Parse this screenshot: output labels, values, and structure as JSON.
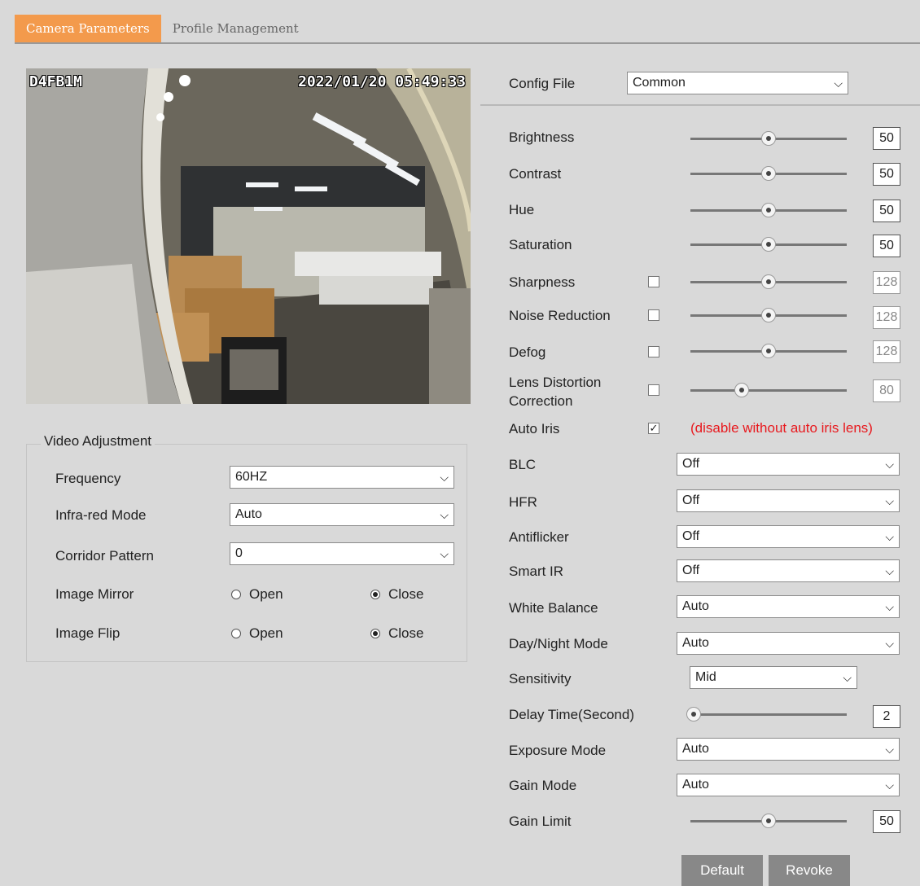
{
  "tabs": [
    {
      "label": "Camera Parameters",
      "active": true
    },
    {
      "label": "Profile Management",
      "active": false
    }
  ],
  "preview": {
    "camera_id": "D4FB1M",
    "timestamp": "2022/01/20 05:49:33"
  },
  "video_adjustment": {
    "legend": "Video Adjustment",
    "frequency": {
      "label": "Frequency",
      "value": "60HZ"
    },
    "infrared": {
      "label": "Infra-red Mode",
      "value": "Auto"
    },
    "corridor": {
      "label": "Corridor Pattern",
      "value": "0"
    },
    "mirror": {
      "label": "Image Mirror",
      "open": "Open",
      "close": "Close",
      "selected": "Close"
    },
    "flip": {
      "label": "Image Flip",
      "open": "Open",
      "close": "Close",
      "selected": "Close"
    }
  },
  "config_file": {
    "label": "Config File",
    "value": "Common"
  },
  "sliders": {
    "brightness": {
      "label": "Brightness",
      "value": "50",
      "fraction": 0.5
    },
    "contrast": {
      "label": "Contrast",
      "value": "50",
      "fraction": 0.5
    },
    "hue": {
      "label": "Hue",
      "value": "50",
      "fraction": 0.5
    },
    "saturation": {
      "label": "Saturation",
      "value": "50",
      "fraction": 0.5
    },
    "sharpness": {
      "label": "Sharpness",
      "value": "128",
      "fraction": 0.5,
      "checked": false
    },
    "noise": {
      "label": "Noise Reduction",
      "value": "128",
      "fraction": 0.5,
      "checked": false
    },
    "defog": {
      "label": "Defog",
      "value": "128",
      "fraction": 0.5,
      "checked": false
    },
    "lens": {
      "label_line1": "Lens Distortion",
      "label_line2": "Correction",
      "value": "80",
      "fraction": 0.33,
      "checked": false
    },
    "delay": {
      "label": "Delay Time(Second)",
      "value": "2",
      "fraction": 0.02
    },
    "gain_limit": {
      "label": "Gain Limit",
      "value": "50",
      "fraction": 0.5
    }
  },
  "auto_iris": {
    "label": "Auto Iris",
    "checked": true,
    "warning": "(disable without auto iris lens)"
  },
  "dropdowns": {
    "blc": {
      "label": "BLC",
      "value": "Off"
    },
    "hfr": {
      "label": "HFR",
      "value": "Off"
    },
    "antiflicker": {
      "label": "Antiflicker",
      "value": "Off"
    },
    "smart_ir": {
      "label": "Smart IR",
      "value": "Off"
    },
    "white_balance": {
      "label": "White Balance",
      "value": "Auto"
    },
    "day_night": {
      "label": "Day/Night Mode",
      "value": "Auto"
    },
    "sensitivity": {
      "label": "Sensitivity",
      "value": "Mid"
    },
    "exposure": {
      "label": "Exposure Mode",
      "value": "Auto"
    },
    "gain_mode": {
      "label": "Gain Mode",
      "value": "Auto"
    }
  },
  "buttons": {
    "default": "Default",
    "revoke": "Revoke"
  },
  "colors": {
    "active_tab": "#f39a4c",
    "warning": "#e8191e",
    "background": "#d9d9d9"
  }
}
